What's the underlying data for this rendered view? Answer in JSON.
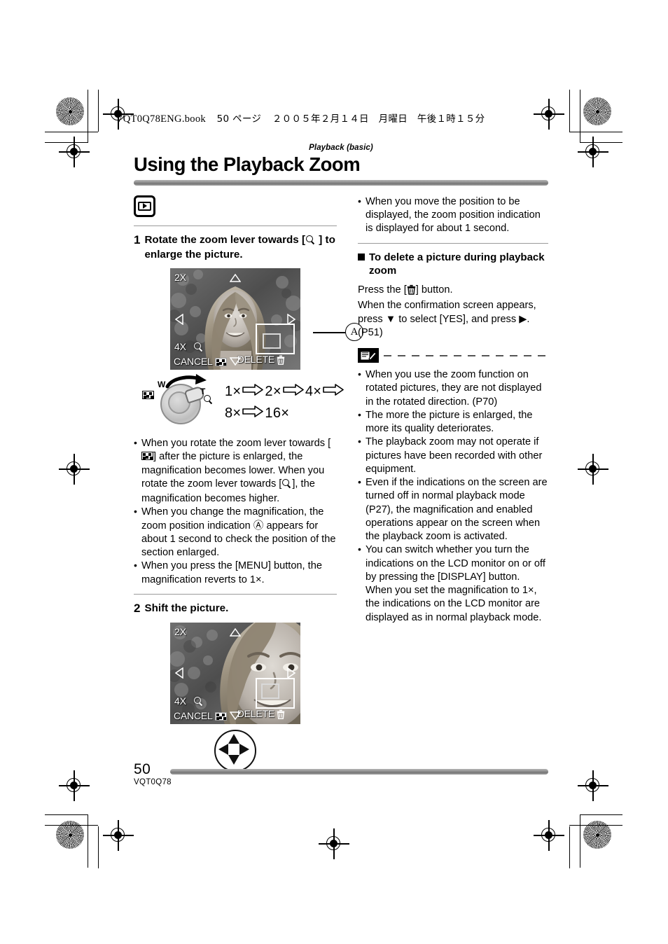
{
  "print_marks": {
    "book_line": {
      "filename": "VQT0Q78ENG.book",
      "page_label": "50 ページ",
      "date": "２００５年２月１４日　月曜日　午後１時１５分"
    }
  },
  "header": {
    "kicker": "Playback (basic)",
    "title": "Using the Playback Zoom"
  },
  "mode_icon": {
    "name": "playback-mode-icon"
  },
  "left_column": {
    "step1": {
      "number": "1",
      "text_before": "Rotate the zoom lever towards [",
      "text_after": "] to enlarge the picture."
    },
    "screen1": {
      "mag_top": "2X",
      "mag_bottom": "4X",
      "cancel": "CANCEL",
      "delete": "DELETE",
      "callout": "A"
    },
    "lever": {
      "w_label": "W",
      "t_label": "T",
      "sequence_row1": [
        "1×",
        "2×",
        "4×"
      ],
      "sequence_row2": [
        "8×",
        "16×"
      ]
    },
    "bullets": [
      "When you rotate the zoom lever towards [▩] after the picture is enlarged, the magnification becomes lower. When you rotate the zoom lever towards [⌕], the magnification becomes higher.",
      "When you change the magnification, the zoom position indication Ⓐ appears for about 1 second to check the position of the section enlarged.",
      "When you press the [MENU] button, the magnification reverts to 1×."
    ],
    "bullet1_part1": "When you rotate the zoom lever towards",
    "bullet1_part2": "] after the picture is enlarged, the magnification becomes lower. When you rotate the zoom lever towards [",
    "bullet1_part3": "], the magnification becomes higher.",
    "bullet2": "When you change the magnification, the zoom position indication Ⓐ appears for about 1 second to check the position of the section enlarged.",
    "bullet3": "When you press the [MENU] button, the magnification reverts to 1×.",
    "step2": {
      "number": "2",
      "text": "Shift the picture."
    },
    "screen2": {
      "mag_top": "2X",
      "mag_bottom": "4X",
      "cancel": "CANCEL",
      "delete": "DELETE"
    }
  },
  "right_column": {
    "bullet_top": "When you move the position to be displayed, the zoom position indication is displayed for about 1 second.",
    "subhead": "To delete a picture during playback zoom",
    "delete_steps": {
      "line1_before": "Press the [",
      "line1_after": "] button.",
      "line2": "When the confirmation screen appears, press ▼ to select [YES], and press ▶. (P51)"
    },
    "notes": [
      "When you use the zoom function on rotated pictures, they are not displayed in the rotated direction. (P70)",
      "The more the picture is enlarged, the more its quality deteriorates.",
      "The playback zoom may not operate if pictures have been recorded with other equipment.",
      "Even if the indications on the screen are turned off in normal playback mode (P27), the magnification and enabled operations appear on the screen when the playback zoom is activated.",
      "You can switch whether you turn the indications on the LCD monitor on or off by pressing the [DISPLAY] button. When you set the magnification to 1×, the indications on the LCD monitor are displayed as in normal playback mode."
    ]
  },
  "footer": {
    "page_number": "50",
    "doc_code": "VQT0Q78"
  },
  "colors": {
    "rule_gray": "#8f8f8f",
    "text": "#000000",
    "paper": "#ffffff"
  }
}
